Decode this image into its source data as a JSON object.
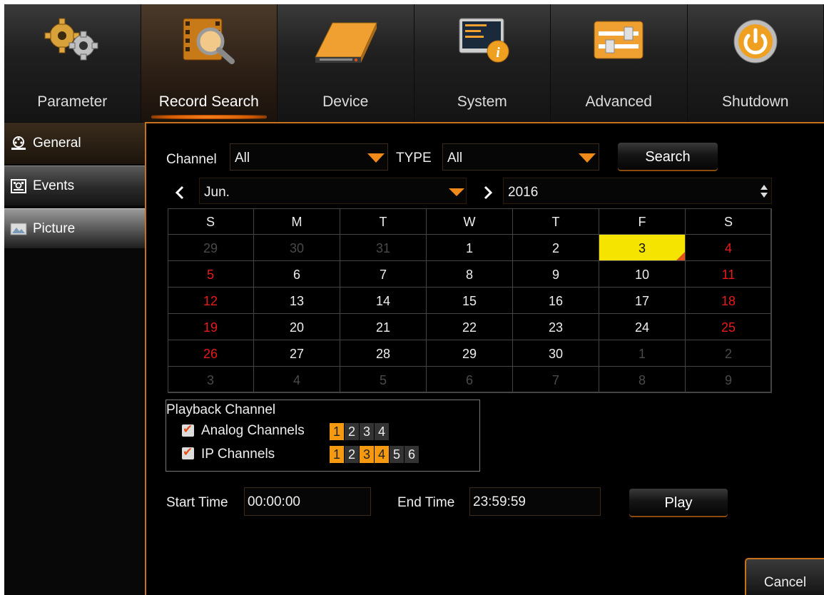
{
  "menu": [
    {
      "label": "Parameter",
      "icon": "gears-icon"
    },
    {
      "label": "Record Search",
      "icon": "film-magnifier-icon",
      "active": true
    },
    {
      "label": "Device",
      "icon": "hard-drive-icon"
    },
    {
      "label": "System",
      "icon": "system-info-icon"
    },
    {
      "label": "Advanced",
      "icon": "sliders-icon"
    },
    {
      "label": "Shutdown",
      "icon": "power-icon"
    }
  ],
  "sidebar": {
    "items": [
      {
        "label": "General",
        "icon": "film-reel-icon"
      },
      {
        "label": "Events",
        "icon": "event-film-icon"
      },
      {
        "label": "Picture",
        "icon": "picture-icon"
      }
    ]
  },
  "filters": {
    "channel_label": "Channel",
    "channel_value": "All",
    "type_label": "TYPE",
    "type_value": "All",
    "search_label": "Search"
  },
  "calendar": {
    "month": "Jun.",
    "year": "2016",
    "weekdays": [
      "S",
      "M",
      "T",
      "W",
      "T",
      "F",
      "S"
    ],
    "selected_day": "3",
    "weeks": [
      [
        "29",
        "30",
        "31",
        "1",
        "2",
        "3",
        "4"
      ],
      [
        "5",
        "6",
        "7",
        "8",
        "9",
        "10",
        "11"
      ],
      [
        "12",
        "13",
        "14",
        "15",
        "16",
        "17",
        "18"
      ],
      [
        "19",
        "20",
        "21",
        "22",
        "23",
        "24",
        "25"
      ],
      [
        "26",
        "27",
        "28",
        "29",
        "30",
        "1",
        "2"
      ],
      [
        "3",
        "4",
        "5",
        "6",
        "7",
        "8",
        "9"
      ]
    ]
  },
  "playback": {
    "title": "Playback Channel",
    "analog_label": "Analog Channels",
    "analog_channels": [
      "1",
      "2",
      "3",
      "4"
    ],
    "analog_selected": [
      "1"
    ],
    "ip_label": "IP Channels",
    "ip_channels": [
      "1",
      "2",
      "3",
      "4",
      "5",
      "6"
    ],
    "ip_selected": [
      "1",
      "3",
      "4"
    ]
  },
  "time": {
    "start_label": "Start Time",
    "start_value": "00:00:00",
    "end_label": "End Time",
    "end_value": "23:59:59",
    "play_label": "Play"
  },
  "cancel_label": "Cancel",
  "colors": {
    "accent": "#f08a1a",
    "weekend_red": "#e81a1a",
    "selected_day": "#f5e400",
    "record_marker": "#e0521a"
  }
}
